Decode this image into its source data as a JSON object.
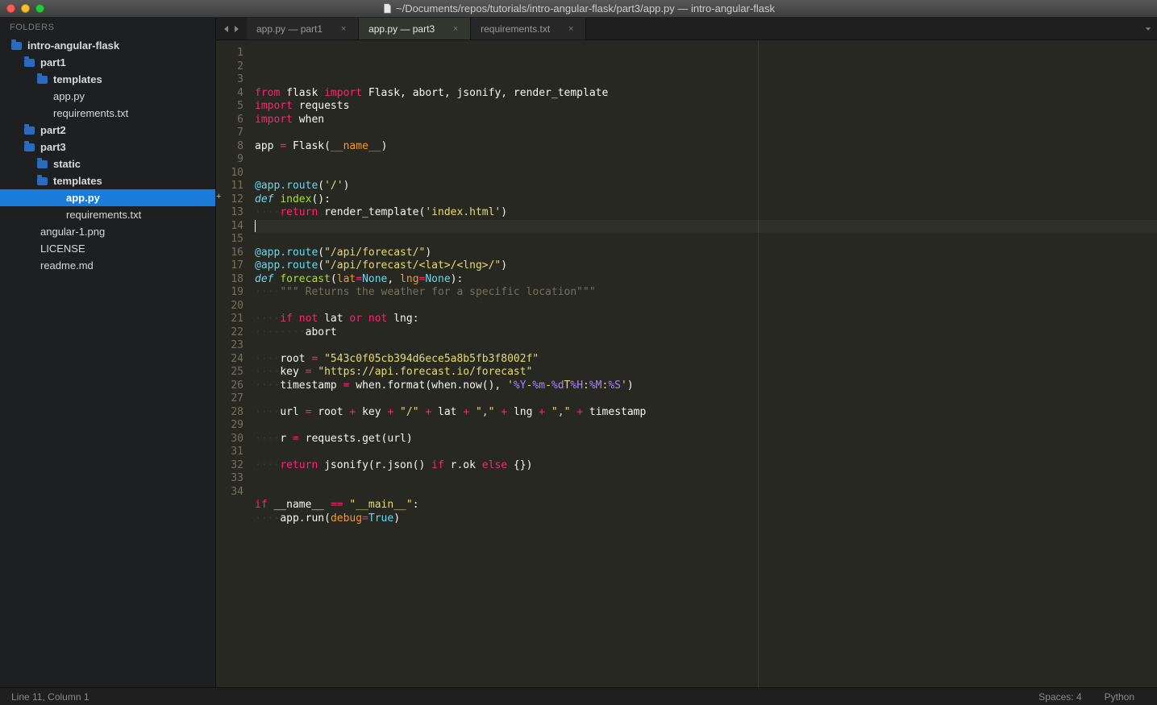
{
  "window": {
    "title": "~/Documents/repos/tutorials/intro-angular-flask/part3/app.py — intro-angular-flask"
  },
  "sidebar": {
    "header": "FOLDERS",
    "tree": [
      {
        "label": "intro-angular-flask",
        "kind": "folder",
        "depth": 0
      },
      {
        "label": "part1",
        "kind": "folder",
        "depth": 1
      },
      {
        "label": "templates",
        "kind": "folder",
        "depth": 2
      },
      {
        "label": "app.py",
        "kind": "file",
        "depth": 2
      },
      {
        "label": "requirements.txt",
        "kind": "file",
        "depth": 2
      },
      {
        "label": "part2",
        "kind": "folder",
        "depth": 1
      },
      {
        "label": "part3",
        "kind": "folder",
        "depth": 1
      },
      {
        "label": "static",
        "kind": "folder",
        "depth": 2
      },
      {
        "label": "templates",
        "kind": "folder",
        "depth": 2
      },
      {
        "label": "app.py",
        "kind": "file",
        "depth": 3,
        "selected": true
      },
      {
        "label": "requirements.txt",
        "kind": "file",
        "depth": 3
      },
      {
        "label": "angular-1.png",
        "kind": "file",
        "depth": 1
      },
      {
        "label": "LICENSE",
        "kind": "file",
        "depth": 1
      },
      {
        "label": "readme.md",
        "kind": "file",
        "depth": 1
      }
    ]
  },
  "tabs": {
    "items": [
      {
        "label": "app.py — part1",
        "active": false
      },
      {
        "label": "app.py — part3",
        "active": true
      },
      {
        "label": "requirements.txt",
        "active": false
      }
    ]
  },
  "editor": {
    "line_count": 34,
    "cursor_line": 11,
    "plus_mark_line": 12,
    "lines": [
      {
        "n": 1,
        "tokens": [
          [
            "k",
            "from"
          ],
          [
            "n",
            " flask "
          ],
          [
            "k",
            "import"
          ],
          [
            "n",
            " Flask, abort, jsonify, render_template"
          ]
        ]
      },
      {
        "n": 2,
        "tokens": [
          [
            "k",
            "import"
          ],
          [
            "n",
            " requests"
          ]
        ]
      },
      {
        "n": 3,
        "tokens": [
          [
            "k",
            "import"
          ],
          [
            "n",
            " when"
          ]
        ]
      },
      {
        "n": 4,
        "tokens": []
      },
      {
        "n": 5,
        "tokens": [
          [
            "n",
            "app "
          ],
          [
            "op",
            "="
          ],
          [
            "n",
            " Flask("
          ],
          [
            "nb",
            "__name__"
          ],
          [
            "n",
            ")"
          ]
        ]
      },
      {
        "n": 6,
        "tokens": []
      },
      {
        "n": 7,
        "tokens": []
      },
      {
        "n": 8,
        "tokens": [
          [
            "d",
            "@app.route"
          ],
          [
            "n",
            "("
          ],
          [
            "s",
            "'/'"
          ],
          [
            "n",
            ")"
          ]
        ]
      },
      {
        "n": 9,
        "tokens": [
          [
            "kd",
            "def"
          ],
          [
            "n",
            " "
          ],
          [
            "f",
            "index"
          ],
          [
            "n",
            "():"
          ]
        ]
      },
      {
        "n": 10,
        "tokens": [
          [
            "dots",
            "····"
          ],
          [
            "k",
            "return"
          ],
          [
            "n",
            " render_template("
          ],
          [
            "s",
            "'index.html'"
          ],
          [
            "n",
            ")"
          ]
        ]
      },
      {
        "n": 11,
        "hl": true,
        "tokens": [
          [
            "cursor",
            ""
          ]
        ]
      },
      {
        "n": 12,
        "tokens": []
      },
      {
        "n": 13,
        "tokens": [
          [
            "d",
            "@app.route"
          ],
          [
            "n",
            "("
          ],
          [
            "s",
            "\"/api/forecast/\""
          ],
          [
            "n",
            ")"
          ]
        ]
      },
      {
        "n": 14,
        "tokens": [
          [
            "d",
            "@app.route"
          ],
          [
            "n",
            "("
          ],
          [
            "s",
            "\"/api/forecast/<lat>/<lng>/\""
          ],
          [
            "n",
            ")"
          ]
        ]
      },
      {
        "n": 15,
        "tokens": [
          [
            "kd",
            "def"
          ],
          [
            "n",
            " "
          ],
          [
            "f",
            "forecast"
          ],
          [
            "n",
            "("
          ],
          [
            "nb",
            "lat"
          ],
          [
            "op",
            "="
          ],
          [
            "d",
            "None"
          ],
          [
            "n",
            ", "
          ],
          [
            "nb",
            "lng"
          ],
          [
            "op",
            "="
          ],
          [
            "d",
            "None"
          ],
          [
            "n",
            "):"
          ]
        ]
      },
      {
        "n": 16,
        "tokens": [
          [
            "dots",
            "····"
          ],
          [
            "c",
            "\"\"\" Returns the weather for a specific location\"\"\""
          ]
        ]
      },
      {
        "n": 17,
        "tokens": []
      },
      {
        "n": 18,
        "tokens": [
          [
            "dots",
            "····"
          ],
          [
            "k",
            "if"
          ],
          [
            "n",
            " "
          ],
          [
            "k",
            "not"
          ],
          [
            "n",
            " lat "
          ],
          [
            "k",
            "or"
          ],
          [
            "n",
            " "
          ],
          [
            "k",
            "not"
          ],
          [
            "n",
            " lng:"
          ]
        ]
      },
      {
        "n": 19,
        "tokens": [
          [
            "dots",
            "········"
          ],
          [
            "n",
            "abort"
          ]
        ]
      },
      {
        "n": 20,
        "tokens": []
      },
      {
        "n": 21,
        "tokens": [
          [
            "dots",
            "····"
          ],
          [
            "n",
            "root "
          ],
          [
            "op",
            "="
          ],
          [
            "n",
            " "
          ],
          [
            "s",
            "\"543c0f05cb394d6ece5a8b5fb3f8002f\""
          ]
        ]
      },
      {
        "n": 22,
        "tokens": [
          [
            "dots",
            "····"
          ],
          [
            "n",
            "key "
          ],
          [
            "op",
            "="
          ],
          [
            "n",
            " "
          ],
          [
            "s",
            "\"https://api.forecast.io/forecast\""
          ]
        ]
      },
      {
        "n": 23,
        "tokens": [
          [
            "dots",
            "····"
          ],
          [
            "n",
            "timestamp "
          ],
          [
            "op",
            "="
          ],
          [
            "n",
            " when.format(when.now(), "
          ],
          [
            "s",
            "'"
          ],
          [
            "sp",
            "%Y"
          ],
          [
            "s",
            "-"
          ],
          [
            "sp",
            "%m"
          ],
          [
            "s",
            "-"
          ],
          [
            "sp",
            "%d"
          ],
          [
            "s",
            "T"
          ],
          [
            "sp",
            "%H"
          ],
          [
            "s",
            ":"
          ],
          [
            "sp",
            "%M"
          ],
          [
            "s",
            ":"
          ],
          [
            "sp",
            "%S"
          ],
          [
            "s",
            "'"
          ],
          [
            "n",
            ")"
          ]
        ]
      },
      {
        "n": 24,
        "tokens": []
      },
      {
        "n": 25,
        "tokens": [
          [
            "dots",
            "····"
          ],
          [
            "n",
            "url "
          ],
          [
            "op",
            "="
          ],
          [
            "n",
            " root "
          ],
          [
            "op",
            "+"
          ],
          [
            "n",
            " key "
          ],
          [
            "op",
            "+"
          ],
          [
            "n",
            " "
          ],
          [
            "s",
            "\"/\""
          ],
          [
            "n",
            " "
          ],
          [
            "op",
            "+"
          ],
          [
            "n",
            " lat "
          ],
          [
            "op",
            "+"
          ],
          [
            "n",
            " "
          ],
          [
            "s",
            "\",\""
          ],
          [
            "n",
            " "
          ],
          [
            "op",
            "+"
          ],
          [
            "n",
            " lng "
          ],
          [
            "op",
            "+"
          ],
          [
            "n",
            " "
          ],
          [
            "s",
            "\",\""
          ],
          [
            "n",
            " "
          ],
          [
            "op",
            "+"
          ],
          [
            "n",
            " timestamp"
          ]
        ]
      },
      {
        "n": 26,
        "tokens": []
      },
      {
        "n": 27,
        "tokens": [
          [
            "dots",
            "····"
          ],
          [
            "n",
            "r "
          ],
          [
            "op",
            "="
          ],
          [
            "n",
            " requests.get(url)"
          ]
        ]
      },
      {
        "n": 28,
        "tokens": []
      },
      {
        "n": 29,
        "tokens": [
          [
            "dots",
            "····"
          ],
          [
            "k",
            "return"
          ],
          [
            "n",
            " jsonify(r.json() "
          ],
          [
            "k",
            "if"
          ],
          [
            "n",
            " r.ok "
          ],
          [
            "k",
            "else"
          ],
          [
            "n",
            " {})"
          ]
        ]
      },
      {
        "n": 30,
        "tokens": []
      },
      {
        "n": 31,
        "tokens": []
      },
      {
        "n": 32,
        "tokens": [
          [
            "k",
            "if"
          ],
          [
            "n",
            " __name__ "
          ],
          [
            "op",
            "=="
          ],
          [
            "n",
            " "
          ],
          [
            "s",
            "\"__main__\""
          ],
          [
            "n",
            ":"
          ]
        ]
      },
      {
        "n": 33,
        "tokens": [
          [
            "dots",
            "····"
          ],
          [
            "n",
            "app.run("
          ],
          [
            "nb",
            "debug"
          ],
          [
            "op",
            "="
          ],
          [
            "d",
            "True"
          ],
          [
            "n",
            ")"
          ]
        ]
      },
      {
        "n": 34,
        "tokens": []
      }
    ]
  },
  "status": {
    "position": "Line 11, Column 1",
    "spaces": "Spaces: 4",
    "language": "Python"
  }
}
